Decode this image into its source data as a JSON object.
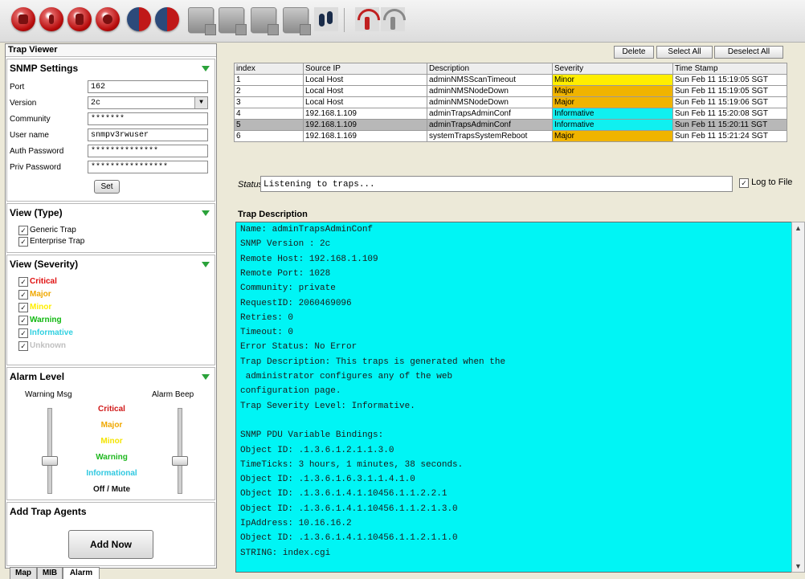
{
  "toolbar": {
    "icons": [
      "record-icon",
      "stop-icon",
      "pause-icon",
      "clear-icon",
      "filter-icon",
      "severity-icon",
      "trap-list-icon",
      "trap-add-icon",
      "trap-edit-icon",
      "trap-delete-icon",
      "footprints-icon",
      "antenna-icon",
      "antenna-off-icon"
    ]
  },
  "left": {
    "title": "Trap Viewer",
    "snmp": {
      "heading": "SNMP Settings",
      "port_label": "Port",
      "port": "162",
      "version_label": "Version",
      "version": "2c",
      "community_label": "Community",
      "community": "*******",
      "user_label": "User name",
      "user": "snmpv3rwuser",
      "auth_label": "Auth Password",
      "auth": "**************",
      "priv_label": "Priv Password",
      "priv": "****************",
      "set_label": "Set"
    },
    "view_type": {
      "heading": "View (Type)",
      "items": [
        "Generic Trap",
        "Enterprise Trap"
      ]
    },
    "view_severity": {
      "heading": "View (Severity)",
      "items": [
        {
          "label": "Critical",
          "color": "#e01010"
        },
        {
          "label": "Major",
          "color": "#f0a800"
        },
        {
          "label": "Minor",
          "color": "#ffee00"
        },
        {
          "label": "Warning",
          "color": "#10b810"
        },
        {
          "label": "Informative",
          "color": "#30d0e0"
        },
        {
          "label": "Unknown",
          "color": "#c0c0c0"
        }
      ]
    },
    "alarm": {
      "heading": "Alarm Level",
      "warning_label": "Warning Msg",
      "beep_label": "Alarm Beep",
      "levels": [
        {
          "label": "Critical",
          "color": "#d01818"
        },
        {
          "label": "Major",
          "color": "#f0a800"
        },
        {
          "label": "Minor",
          "color": "#f4e400"
        },
        {
          "label": "Warning",
          "color": "#20b820"
        },
        {
          "label": "Informational",
          "color": "#30c8e0"
        },
        {
          "label": "Off / Mute",
          "color": "#111111"
        }
      ]
    },
    "agents": {
      "heading": "Add Trap Agents",
      "button": "Add Now"
    }
  },
  "tabs": [
    "Map",
    "MIB",
    "Alarm"
  ],
  "actions": {
    "delete": "Delete",
    "select_all": "Select All",
    "deselect_all": "Deselect All"
  },
  "table": {
    "columns": [
      "index",
      "Source IP",
      "Description",
      "Severity",
      "Time Stamp"
    ],
    "rows": [
      {
        "index": "1",
        "ip": "Local Host",
        "desc": "adminNMSScanTimeout",
        "sev": "Minor",
        "sev_color": "#ffee00",
        "time": "Sun Feb 11 15:19:05 SGT"
      },
      {
        "index": "2",
        "ip": "Local Host",
        "desc": "adminNMSNodeDown",
        "sev": "Major",
        "sev_color": "#f0b400",
        "time": "Sun Feb 11 15:19:05 SGT"
      },
      {
        "index": "3",
        "ip": "Local Host",
        "desc": "adminNMSNodeDown",
        "sev": "Major",
        "sev_color": "#f0b400",
        "time": "Sun Feb 11 15:19:06 SGT"
      },
      {
        "index": "4",
        "ip": "192.168.1.109",
        "desc": "adminTrapsAdminConf",
        "sev": "Informative",
        "sev_color": "#10f0f0",
        "time": "Sun Feb 11 15:20:08 SGT"
      },
      {
        "index": "5",
        "ip": "192.168.1.109",
        "desc": "adminTrapsAdminConf",
        "sev": "Informative",
        "sev_color": "#10f0f0",
        "time": "Sun Feb 11 15:20:11 SGT"
      },
      {
        "index": "6",
        "ip": "192.168.1.169",
        "desc": "systemTrapsSystemReboot",
        "sev": "Major",
        "sev_color": "#f0b400",
        "time": "Sun Feb 11 15:21:24 SGT"
      }
    ]
  },
  "status": {
    "label": "Status:",
    "value": "Listening to traps...",
    "log_label": "Log to File"
  },
  "description": {
    "title": "Trap Description",
    "lines": [
      "Name: adminTrapsAdminConf",
      "SNMP Version : 2c",
      "Remote Host: 192.168.1.109",
      "Remote Port: 1028",
      "Community: private",
      "RequestID: 2060469096",
      "Retries: 0",
      "Timeout: 0",
      "Error Status: No Error",
      "Trap Description: This traps is generated when the",
      " administrator configures any of the web",
      "configuration page.",
      "Trap Severity Level: Informative.",
      "",
      "SNMP PDU Variable Bindings:",
      "Object ID: .1.3.6.1.2.1.1.3.0",
      "TimeTicks: 3 hours, 1 minutes, 38 seconds.",
      "Object ID: .1.3.6.1.6.3.1.1.4.1.0",
      "Object ID: .1.3.6.1.4.1.10456.1.1.2.2.1",
      "Object ID: .1.3.6.1.4.1.10456.1.1.2.1.3.0",
      "IpAddress: 10.16.16.2",
      "Object ID: .1.3.6.1.4.1.10456.1.1.2.1.1.0",
      "STRING: index.cgi"
    ]
  }
}
